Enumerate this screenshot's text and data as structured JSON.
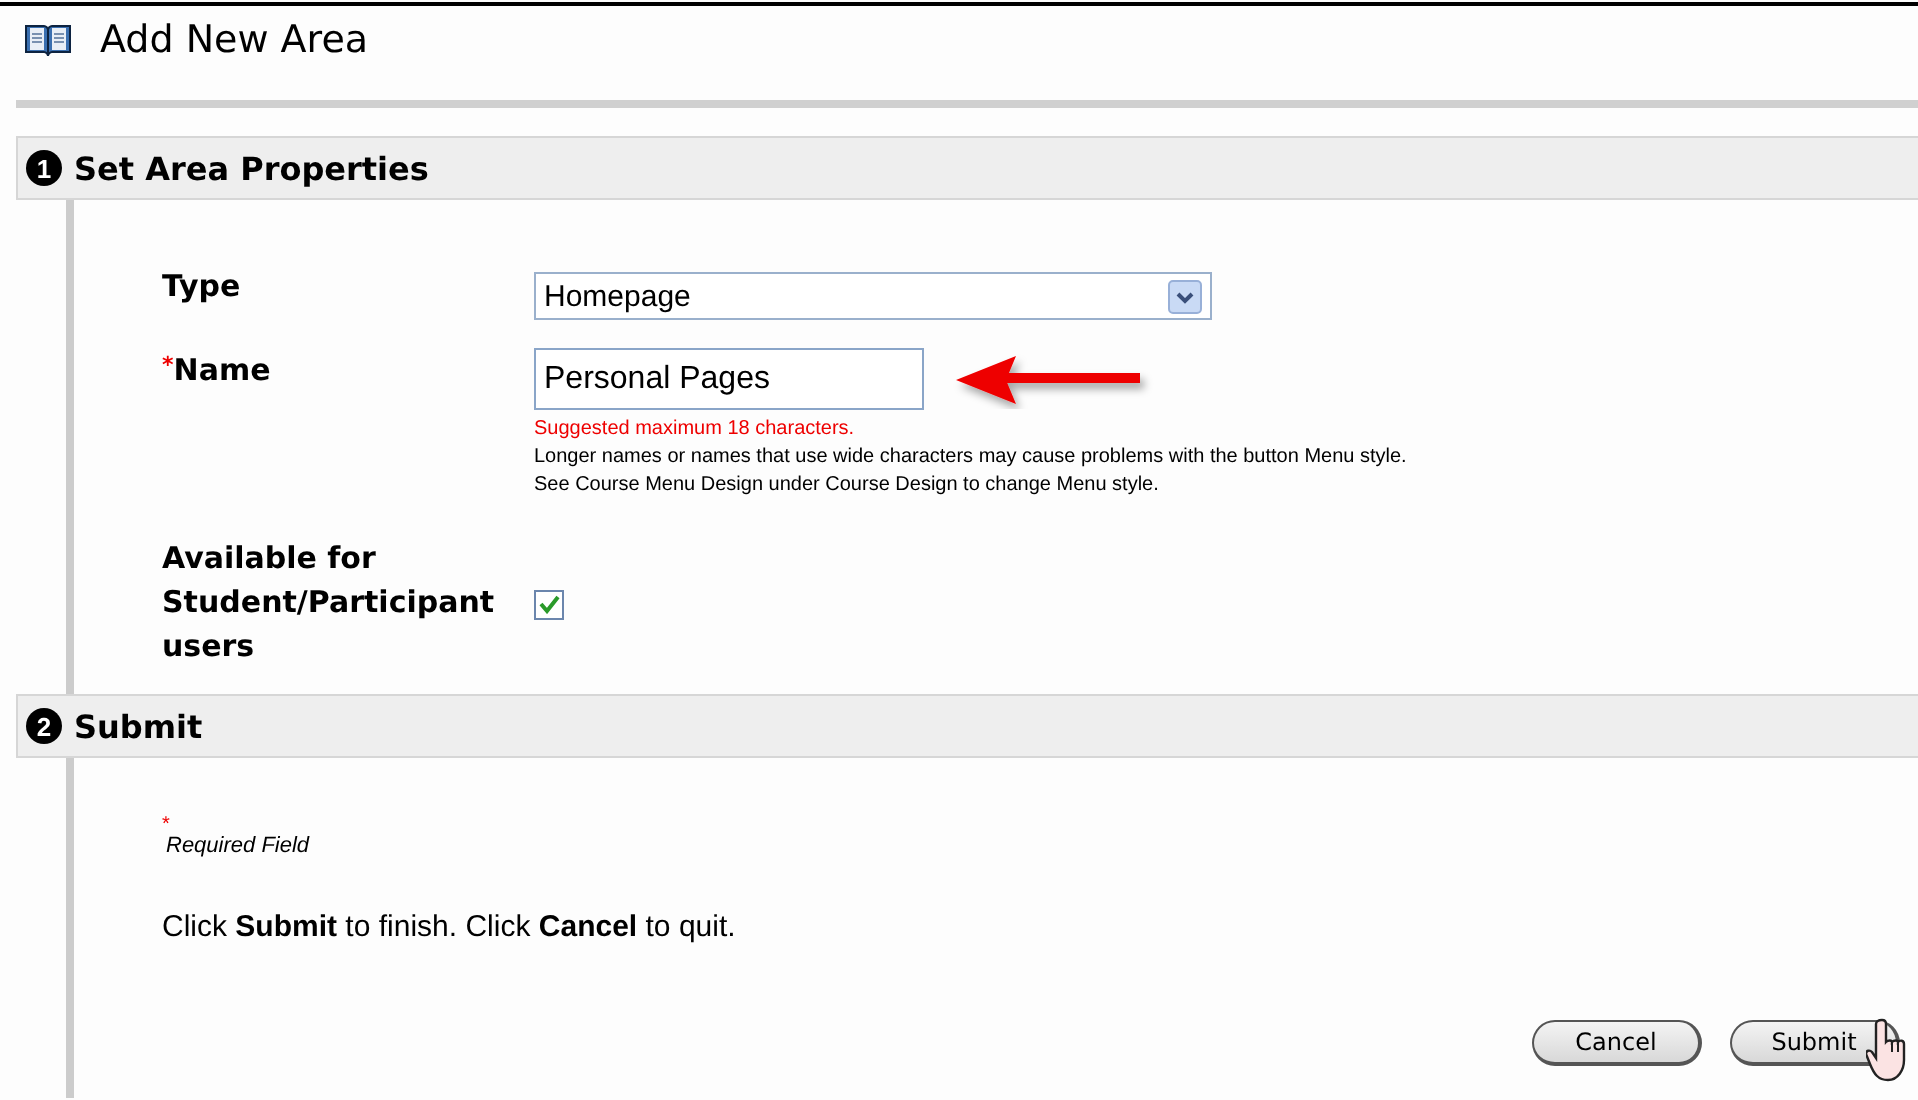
{
  "page": {
    "title": "Add New Area"
  },
  "sections": [
    {
      "number": "1",
      "title": "Set Area Properties",
      "fields": [
        {
          "kind": "select",
          "label": "Type",
          "value": "Homepage"
        },
        {
          "kind": "text",
          "label": "Name",
          "required_mark": "*",
          "value": "Personal Pages",
          "warning": "Suggested maximum 18 characters.",
          "help": [
            "Longer names or names that use wide characters may cause problems with the button Menu style.",
            "See Course Menu Design under Course Design to change Menu style."
          ]
        },
        {
          "kind": "checkbox",
          "label": "Available for Student/Participant users",
          "checked": true
        }
      ]
    },
    {
      "number": "2",
      "title": "Submit",
      "required_note": {
        "mark": "*",
        "text": "Required Field"
      },
      "instruction": "Click **Submit** to finish. Click **Cancel** to quit.",
      "buttons": [
        {
          "label": "Cancel",
          "pointer": false
        },
        {
          "label": "Submit",
          "pointer": true
        }
      ]
    }
  ]
}
